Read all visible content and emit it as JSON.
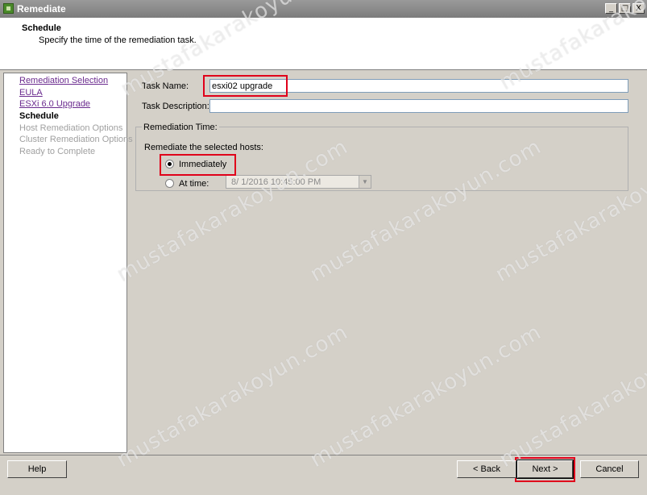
{
  "window": {
    "title": "Remediate",
    "minimize_glyph": "_",
    "maximize_glyph": "□",
    "close_glyph": "X"
  },
  "header": {
    "title": "Schedule",
    "subtitle": "Specify the time of the remediation task."
  },
  "steps": [
    {
      "label": "Remediation Selection",
      "state": "link"
    },
    {
      "label": "EULA",
      "state": "link"
    },
    {
      "label": "ESXi 6.0 Upgrade",
      "state": "link"
    },
    {
      "label": "Schedule",
      "state": "current"
    },
    {
      "label": "Host Remediation Options",
      "state": "disabled"
    },
    {
      "label": "Cluster Remediation Options",
      "state": "disabled"
    },
    {
      "label": "Ready to Complete",
      "state": "disabled"
    }
  ],
  "form": {
    "task_name_label": "Task Name:",
    "task_name_value": "esxi02 upgrade",
    "task_description_label": "Task Description:",
    "task_description_value": "",
    "remediation_time_legend": "Remediation Time:",
    "remediate_hosts_label": "Remediate the selected hosts:",
    "option_immediately": "Immediately",
    "option_at_time": "At time:",
    "at_time_value": "8/  1/2016 10:45:00 PM",
    "selected_option": "Immediately"
  },
  "footer": {
    "help_label": "Help",
    "back_label": "< Back",
    "next_label": "Next >",
    "cancel_label": "Cancel"
  },
  "watermark_text": "mustafakarakoyun.com",
  "colors": {
    "highlight": "#e0001a",
    "visited_link": "#6a2a8e",
    "dialog_bg": "#d4d0c8"
  }
}
